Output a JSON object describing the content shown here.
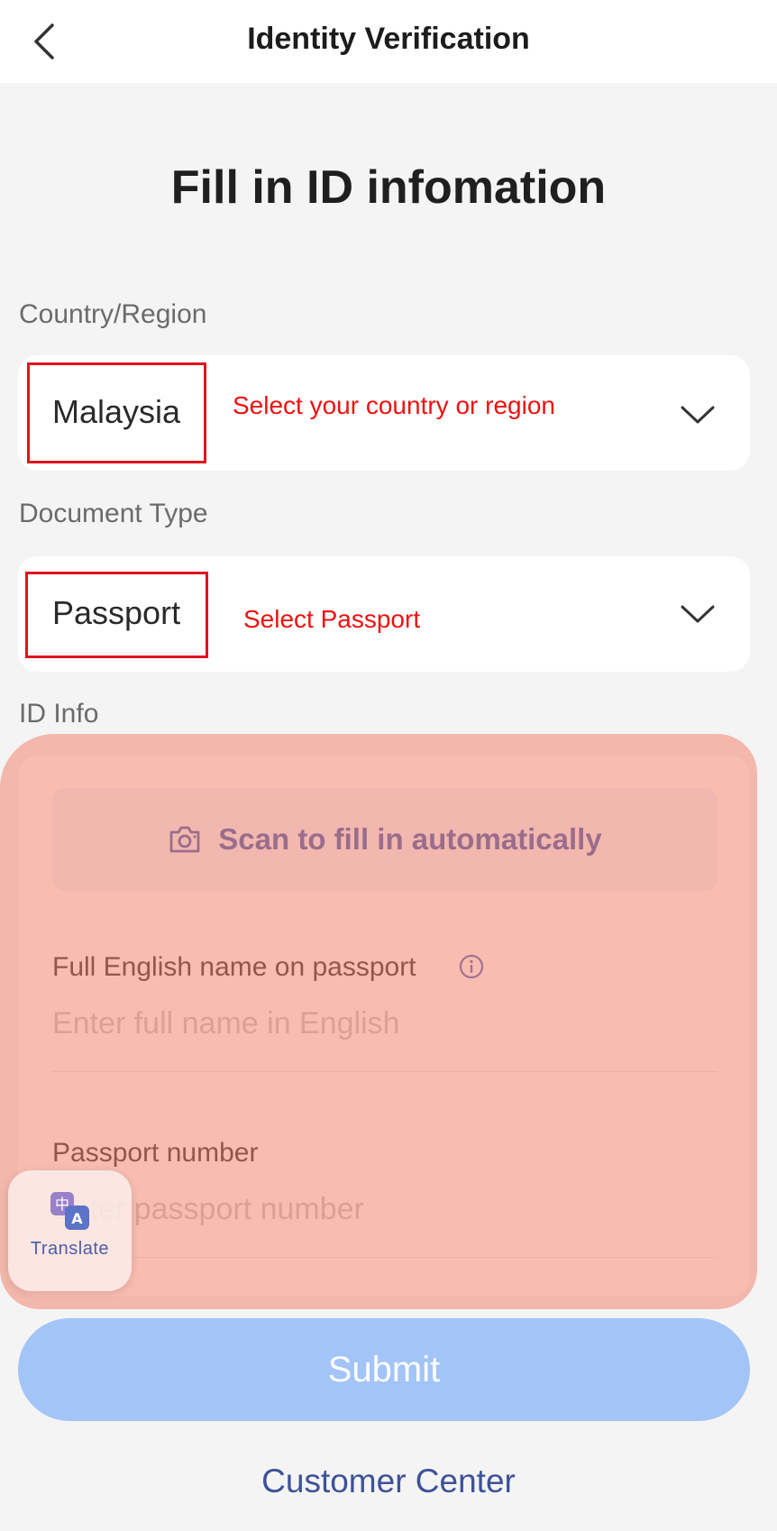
{
  "header": {
    "title": "Identity Verification",
    "back_icon": "chevron-left-icon"
  },
  "page_title": "Fill in ID infomation",
  "country": {
    "label": "Country/Region",
    "value": "Malaysia",
    "annotation": "Select your country or region",
    "icon": "chevron-down-icon"
  },
  "document": {
    "label": "Document Type",
    "value": "Passport",
    "annotation": "Select Passport",
    "icon": "chevron-down-icon"
  },
  "id_info": {
    "label": "ID Info",
    "scan_label": "Scan to fill in automatically",
    "scan_icon": "camera-icon",
    "name_field": {
      "label": "Full English name on passport",
      "placeholder": "Enter full name in English",
      "value": "",
      "info_icon": "info-icon"
    },
    "passport_field": {
      "label": "Passport number",
      "placeholder": "Enter passport number",
      "value": ""
    }
  },
  "translate": {
    "label": "Translate",
    "icon": "translate-icon"
  },
  "submit_label": "Submit",
  "customer_center_label": "Customer Center",
  "colors": {
    "annotation_red": "#ee1111",
    "overlay": "#f27e68",
    "accent_blue": "#3d5bb5",
    "submit_disabled": "#a3c4f7",
    "background": "#f4f4f4"
  }
}
